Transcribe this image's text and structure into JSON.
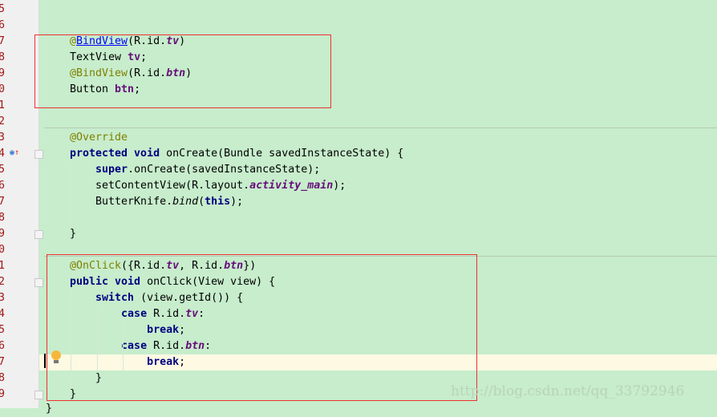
{
  "editor": {
    "background": "#c7edcc",
    "line_numbers": [
      "5",
      "6",
      "7",
      "8",
      "9",
      "0",
      "1",
      "2",
      "3",
      "4",
      "5",
      "6",
      "7",
      "8",
      "9",
      "0",
      "1",
      "2",
      "3",
      "4",
      "5",
      "6",
      "7",
      "8",
      "9"
    ],
    "lines": [
      [],
      [],
      [
        [
          "@",
          "a"
        ],
        [
          "BindView",
          "l"
        ],
        [
          "(R.id.",
          ""
        ],
        [
          "tv",
          "fi"
        ],
        [
          ")",
          ""
        ]
      ],
      [
        [
          "TextView ",
          ""
        ],
        [
          "tv",
          "f"
        ],
        [
          ";",
          ""
        ]
      ],
      [
        [
          "@BindView",
          "a"
        ],
        [
          "(R.id.",
          ""
        ],
        [
          "btn",
          "fi"
        ],
        [
          ")",
          ""
        ]
      ],
      [
        [
          "Button ",
          ""
        ],
        [
          "btn",
          "f"
        ],
        [
          ";",
          ""
        ]
      ],
      [],
      [],
      [
        [
          "@Override",
          "a"
        ]
      ],
      [
        [
          "protected void ",
          "k"
        ],
        [
          "onCreate(Bundle savedInstanceState) {",
          ""
        ]
      ],
      [
        [
          "    ",
          ""
        ],
        [
          "super",
          "k"
        ],
        [
          ".onCreate(savedInstanceState);",
          ""
        ]
      ],
      [
        [
          "    setContentView(R.layout.",
          ""
        ],
        [
          "activity_main",
          "fi"
        ],
        [
          ");",
          ""
        ]
      ],
      [
        [
          "    ButterKnife.",
          ""
        ],
        [
          "bind",
          "s"
        ],
        [
          "(",
          ""
        ],
        [
          "this",
          "k"
        ],
        [
          ");",
          ""
        ]
      ],
      [],
      [
        [
          "}",
          ""
        ]
      ],
      [],
      [
        [
          "@OnClick",
          "a"
        ],
        [
          "({R.id.",
          ""
        ],
        [
          "tv",
          "fi"
        ],
        [
          ", R.id.",
          ""
        ],
        [
          "btn",
          "fi"
        ],
        [
          "})",
          ""
        ]
      ],
      [
        [
          "public void ",
          "k"
        ],
        [
          "onClick(View view) {",
          ""
        ]
      ],
      [
        [
          "    ",
          ""
        ],
        [
          "switch",
          "k"
        ],
        [
          " (view.getId()) {",
          ""
        ]
      ],
      [
        [
          "        ",
          ""
        ],
        [
          "case ",
          "k"
        ],
        [
          "R.id.",
          ""
        ],
        [
          "tv",
          "fi"
        ],
        [
          ":",
          ""
        ]
      ],
      [
        [
          "            ",
          ""
        ],
        [
          "break",
          "k"
        ],
        [
          ";",
          ""
        ]
      ],
      [
        [
          "        ",
          ""
        ],
        [
          "case ",
          "k"
        ],
        [
          "R.id.",
          ""
        ],
        [
          "btn",
          "fi"
        ],
        [
          ":",
          ""
        ]
      ],
      [
        [
          "            ",
          ""
        ],
        [
          "break",
          "k"
        ],
        [
          ";",
          ""
        ]
      ],
      [
        [
          "    }",
          ""
        ]
      ],
      [
        [
          "}",
          ""
        ]
      ]
    ],
    "closing_brace": "}",
    "current_line_index": 22
  },
  "icons": {
    "gutter_override": "override-method-icon",
    "intention": "lightbulb-icon",
    "fold": "fold-marker-icon"
  },
  "highlight_color": "#f03030",
  "watermark": "http://blog.csdn.net/qq_33792946"
}
